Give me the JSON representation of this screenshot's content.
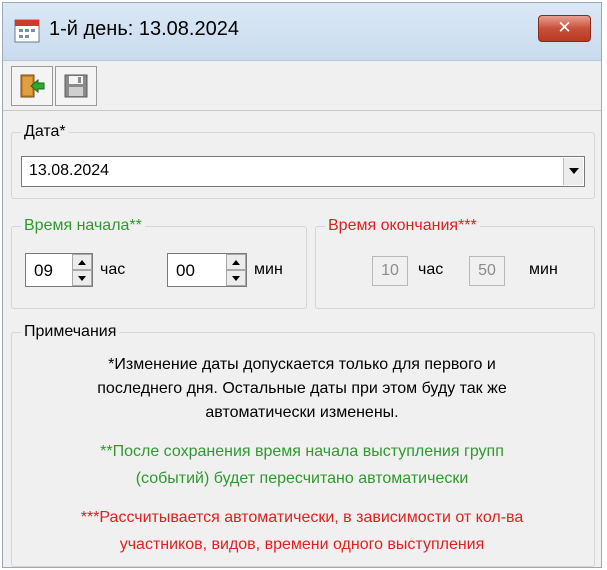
{
  "window": {
    "title": "1-й день: 13.08.2024",
    "close_label": "✕"
  },
  "toolbar": {
    "exit_icon": "exit-door-icon",
    "save_icon": "floppy-disk-icon"
  },
  "date_group": {
    "legend": "Дата*",
    "value": "13.08.2024"
  },
  "start_group": {
    "legend": "Время начала**",
    "legend_color": "#2e9a2e",
    "hours": "09",
    "hours_unit": "час",
    "minutes": "00",
    "minutes_unit": "мин"
  },
  "end_group": {
    "legend": "Время окончания***",
    "legend_color": "#e02020",
    "hours": "10",
    "hours_unit": "час",
    "minutes": "50",
    "minutes_unit": "мин"
  },
  "notes_group": {
    "legend": "Примечания",
    "note1_line1": "*Изменение даты допускается только для первого и",
    "note1_line2": "последнего дня. Остальные даты при этом буду так же",
    "note1_line3": "автоматически изменены.",
    "note2_line1": "**После сохранения время начала выступления групп",
    "note2_line2": "(событий) будет пересчитано автоматически",
    "note2_color": "#2e9a2e",
    "note3_line1": "***Рассчитывается автоматически, в зависимости от кол-ва",
    "note3_line2": "участников, видов, времени одного выступления",
    "note3_color": "#e02020"
  }
}
